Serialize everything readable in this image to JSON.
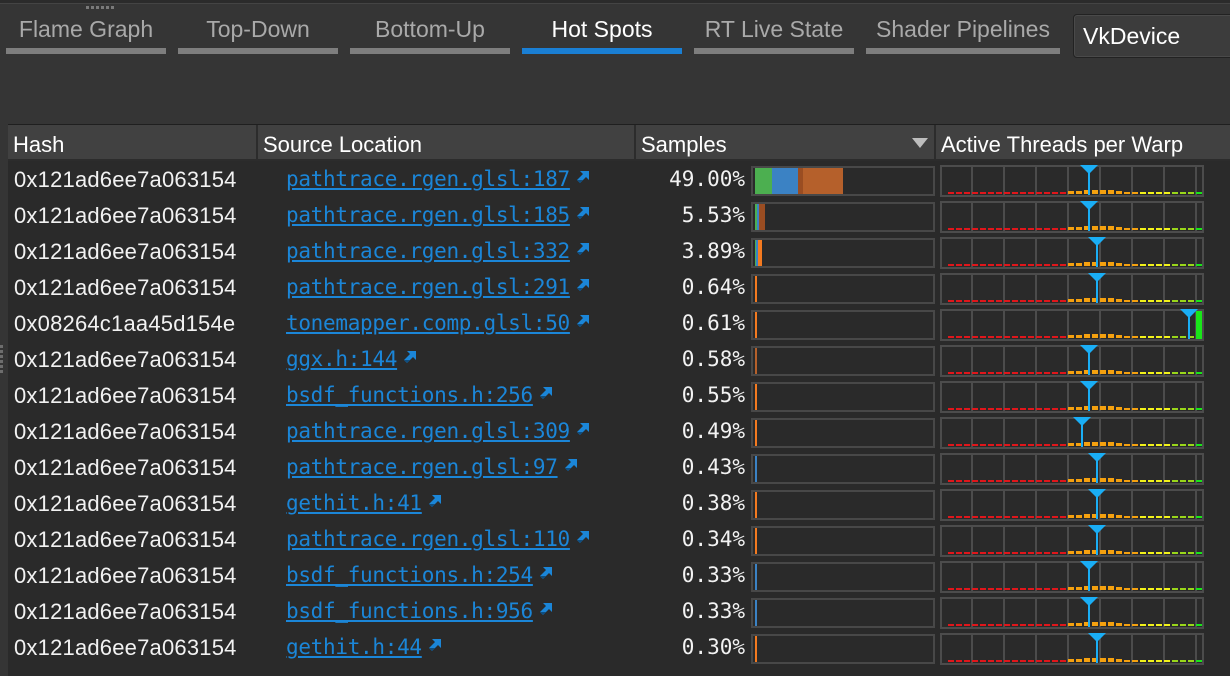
{
  "tabs": [
    {
      "label": "Flame Graph",
      "active": false
    },
    {
      "label": "Top-Down",
      "active": false
    },
    {
      "label": "Bottom-Up",
      "active": false
    },
    {
      "label": "Hot Spots",
      "active": true
    },
    {
      "label": "RT Live State",
      "active": false
    },
    {
      "label": "Shader Pipelines",
      "active": false
    }
  ],
  "device_select": {
    "value": "VkDevice"
  },
  "table": {
    "columns": [
      "Hash",
      "Source Location",
      "Samples",
      "Active Threads per Warp"
    ],
    "sort_column": "Samples",
    "sort_direction": "descending",
    "rows": [
      {
        "hash": "0x121ad6ee7a063154",
        "source": "pathtrace.rgen.glsl:187",
        "samples": "49.00%",
        "fraction": 0.49,
        "segments": [
          {
            "color": "#4caf50",
            "share": 0.19
          },
          {
            "color": "#3b82c4",
            "share": 0.29
          },
          {
            "color": "#9a4d22",
            "share": 0.06
          },
          {
            "color": "#b5602b",
            "share": 0.46
          }
        ],
        "warp_marker": 0.57
      },
      {
        "hash": "0x121ad6ee7a063154",
        "source": "pathtrace.rgen.glsl:185",
        "samples": "5.53%",
        "fraction": 0.0553,
        "segments": [
          {
            "color": "#4caf50",
            "share": 0.2
          },
          {
            "color": "#3b82c4",
            "share": 0.2
          },
          {
            "color": "#9a4d22",
            "share": 0.6
          }
        ],
        "warp_marker": 0.57
      },
      {
        "hash": "0x121ad6ee7a063154",
        "source": "pathtrace.rgen.glsl:332",
        "samples": "3.89%",
        "fraction": 0.0389,
        "segments": [
          {
            "color": "#4caf50",
            "share": 0.12
          },
          {
            "color": "#3b82c4",
            "share": 0.25
          },
          {
            "color": "#f47a20",
            "share": 0.63
          }
        ],
        "warp_marker": 0.6
      },
      {
        "hash": "0x121ad6ee7a063154",
        "source": "pathtrace.rgen.glsl:291",
        "samples": "0.64%",
        "fraction": 0.0064,
        "segments": [
          {
            "color": "#f47a20",
            "share": 1
          }
        ],
        "warp_marker": 0.6
      },
      {
        "hash": "0x08264c1aa45d154e",
        "source": "tonemapper.comp.glsl:50",
        "samples": "0.61%",
        "fraction": 0.0061,
        "segments": [
          {
            "color": "#f47a20",
            "share": 1
          }
        ],
        "warp_marker": 0.97
      },
      {
        "hash": "0x121ad6ee7a063154",
        "source": "ggx.h:144",
        "samples": "0.58%",
        "fraction": 0.0058,
        "segments": [
          {
            "color": "#b5602b",
            "share": 1
          }
        ],
        "warp_marker": 0.57
      },
      {
        "hash": "0x121ad6ee7a063154",
        "source": "bsdf_functions.h:256",
        "samples": "0.55%",
        "fraction": 0.0055,
        "segments": [
          {
            "color": "#f47a20",
            "share": 1
          }
        ],
        "warp_marker": 0.57
      },
      {
        "hash": "0x121ad6ee7a063154",
        "source": "pathtrace.rgen.glsl:309",
        "samples": "0.49%",
        "fraction": 0.0049,
        "segments": [
          {
            "color": "#f47a20",
            "share": 1
          }
        ],
        "warp_marker": 0.54
      },
      {
        "hash": "0x121ad6ee7a063154",
        "source": "pathtrace.rgen.glsl:97",
        "samples": "0.43%",
        "fraction": 0.0043,
        "segments": [
          {
            "color": "#3b82c4",
            "share": 1
          }
        ],
        "warp_marker": 0.6
      },
      {
        "hash": "0x121ad6ee7a063154",
        "source": "gethit.h:41",
        "samples": "0.38%",
        "fraction": 0.0038,
        "segments": [
          {
            "color": "#f47a20",
            "share": 1
          }
        ],
        "warp_marker": 0.6
      },
      {
        "hash": "0x121ad6ee7a063154",
        "source": "pathtrace.rgen.glsl:110",
        "samples": "0.34%",
        "fraction": 0.0034,
        "segments": [
          {
            "color": "#f47a20",
            "share": 1
          }
        ],
        "warp_marker": 0.6
      },
      {
        "hash": "0x121ad6ee7a063154",
        "source": "bsdf_functions.h:254",
        "samples": "0.33%",
        "fraction": 0.0033,
        "segments": [
          {
            "color": "#3b82c4",
            "share": 1
          }
        ],
        "warp_marker": 0.57
      },
      {
        "hash": "0x121ad6ee7a063154",
        "source": "bsdf_functions.h:956",
        "samples": "0.33%",
        "fraction": 0.0033,
        "segments": [
          {
            "color": "#3b82c4",
            "share": 1
          }
        ],
        "warp_marker": 0.57
      },
      {
        "hash": "0x121ad6ee7a063154",
        "source": "gethit.h:44",
        "samples": "0.30%",
        "fraction": 0.003,
        "segments": [
          {
            "color": "#f47a20",
            "share": 1
          }
        ],
        "warp_marker": 0.6
      }
    ]
  },
  "colors": {
    "accent": "#1a7fd4",
    "link": "#1b86d8",
    "warp_marker": "#1aaef5",
    "warp_low": "#e0161b",
    "warp_mid": "#f5a10f",
    "warp_high_yellow": "#f2f21a",
    "warp_high_lime": "#99d61a",
    "warp_full": "#19e619"
  }
}
